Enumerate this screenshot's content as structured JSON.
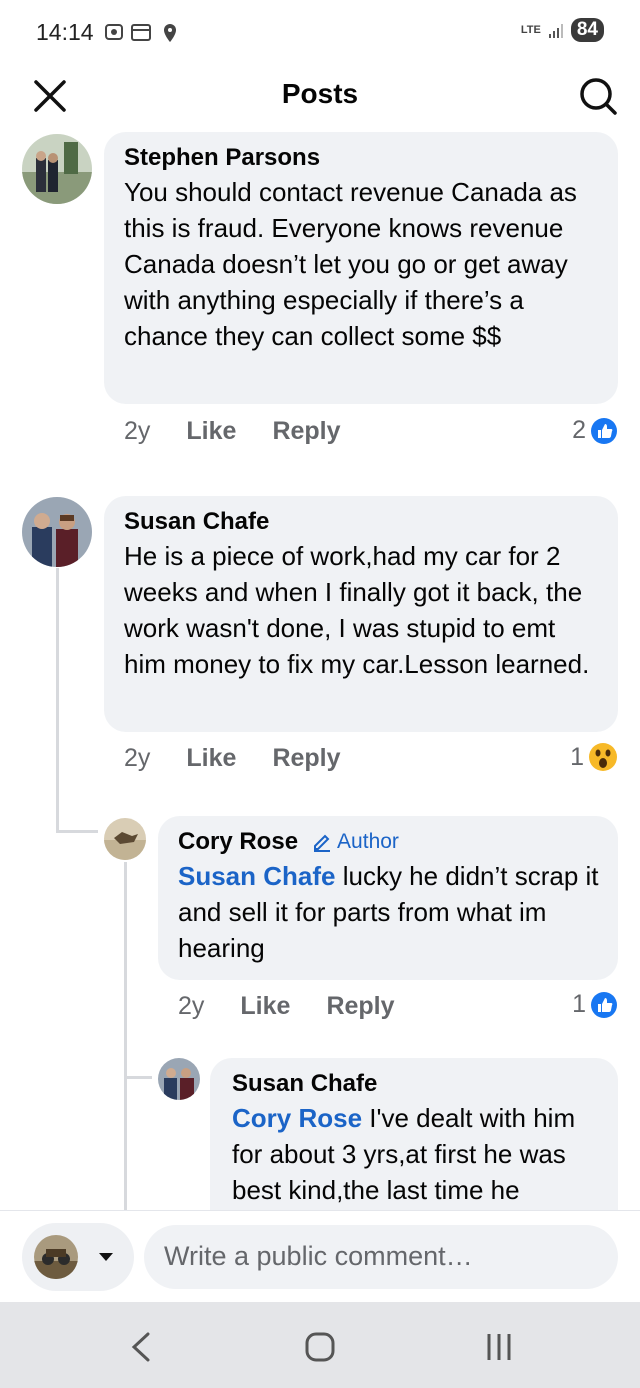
{
  "status_bar": {
    "time": "14:14",
    "network": "LTE",
    "battery": "84"
  },
  "header": {
    "title": "Posts"
  },
  "comments": [
    {
      "author": "Stephen Parsons",
      "text": "You should contact revenue Canada as this is fraud. Everyone knows revenue Canada doesn’t let you go or get away with anything especially if there’s a chance they can collect some $$",
      "age": "2y",
      "like": "Like",
      "reply": "Reply",
      "reaction_count": "2",
      "reaction": "like-reaction-icon"
    },
    {
      "author": "Susan Chafe",
      "text": "He is a piece of work,had my car for 2 weeks and when I finally got it back, the work wasn't done, I was stupid to emt him money to fix my car.Lesson learned.",
      "age": "2y",
      "like": "Like",
      "reply": "Reply",
      "reaction_count": "1",
      "reaction": "wow-reaction-icon",
      "replies": [
        {
          "author": "Cory Rose",
          "badge": "Author",
          "mention": "Susan Chafe",
          "text": " lucky he didn’t scrap it and sell it for parts from what im hearing",
          "age": "2y",
          "like": "Like",
          "reply": "Reply",
          "reaction_count": "1",
          "reaction": "like-reaction-icon"
        },
        {
          "author": "Susan Chafe",
          "mention": "Cory Rose",
          "text": " I've dealt with him for about 3 yrs,at first he was best kind,the last time he"
        }
      ]
    }
  ],
  "composer": {
    "placeholder": "Write a public comment…"
  },
  "colors": {
    "accent": "#1b64c7",
    "like_blue": "#1877f2",
    "bubble": "#f0f2f5"
  }
}
